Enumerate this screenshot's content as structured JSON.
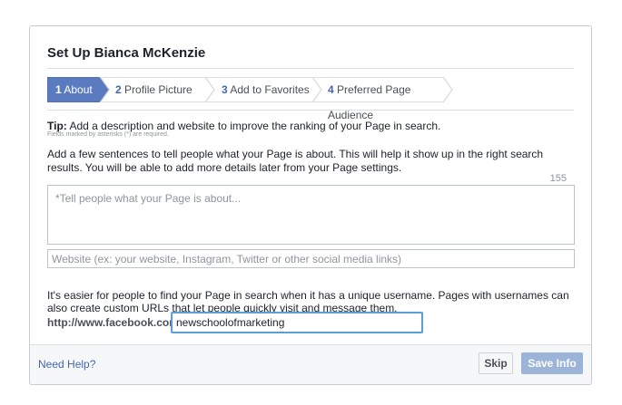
{
  "dialog": {
    "title": "Set Up Bianca McKenzie"
  },
  "steps": [
    {
      "num": "1",
      "label": "About",
      "active": true
    },
    {
      "num": "2",
      "label": "Profile Picture",
      "active": false
    },
    {
      "num": "3",
      "label": "Add to Favorites",
      "active": false
    },
    {
      "num": "4",
      "label": "Preferred Page Audience",
      "active": false
    }
  ],
  "tip": {
    "prefix": "Tip:",
    "text": "Add a description and website to improve the ranking of your Page in search.",
    "required_note": "Fields marked by asterisks (*) are required."
  },
  "about": {
    "description": "Add a few sentences to tell people what your Page is about. This will help it show up in the right search results. You will be able to add more details later from your Page settings.",
    "char_counter": "155",
    "placeholder": "*Tell people what your Page is about..."
  },
  "website": {
    "placeholder": "Website (ex: your website, Instagram, Twitter or other social media links)"
  },
  "username": {
    "description": "It's easier for people to find your Page in search when it has a unique username. Pages with usernames can also create custom URLs that let people quickly visit and message them.",
    "url_prefix": "http://www.facebook.com/",
    "value": "newschoolofmarketing"
  },
  "footer": {
    "help_label": "Need Help?",
    "skip_label": "Skip",
    "save_label": "Save Info"
  },
  "colors": {
    "accent": "#4267b2",
    "active_step": "#5b7bc0",
    "save_disabled": "#9cb4d8",
    "focus_border": "#5b9dd9"
  }
}
